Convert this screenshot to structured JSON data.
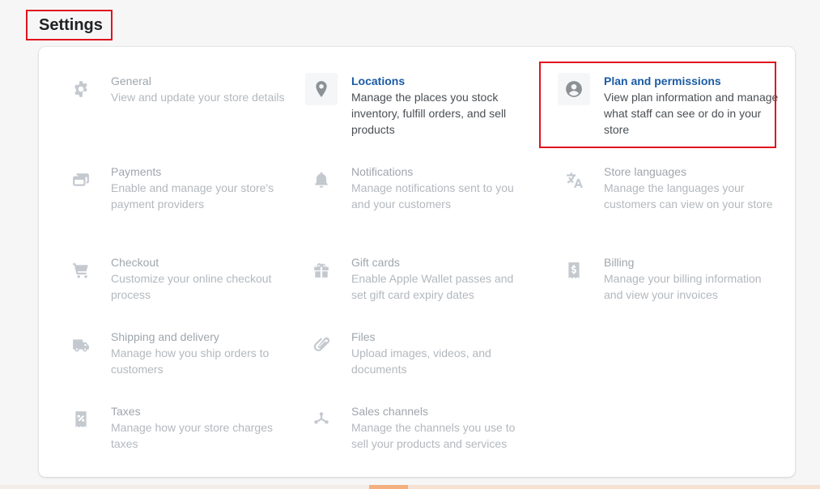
{
  "page": {
    "title": "Settings"
  },
  "settings": [
    {
      "key": "general",
      "icon": "gear-icon",
      "title": "General",
      "description": "View and update your store details"
    },
    {
      "key": "locations",
      "icon": "location-pin-icon",
      "title": "Locations",
      "description": "Manage the places you stock inventory, fulfill orders, and sell products"
    },
    {
      "key": "plan-and-permissions",
      "icon": "user-circle-icon",
      "title": "Plan and permissions",
      "description": "View plan information and manage what staff can see or do in your store"
    },
    {
      "key": "payments",
      "icon": "credit-card-icon",
      "title": "Payments",
      "description": "Enable and manage your store's payment providers"
    },
    {
      "key": "notifications",
      "icon": "bell-icon",
      "title": "Notifications",
      "description": "Manage notifications sent to you and your customers"
    },
    {
      "key": "store-languages",
      "icon": "translate-icon",
      "title": "Store languages",
      "description": "Manage the languages your customers can view on your store"
    },
    {
      "key": "checkout",
      "icon": "cart-icon",
      "title": "Checkout",
      "description": "Customize your online checkout process"
    },
    {
      "key": "gift-cards",
      "icon": "gift-icon",
      "title": "Gift cards",
      "description": "Enable Apple Wallet passes and set gift card expiry dates"
    },
    {
      "key": "billing",
      "icon": "billing-receipt-icon",
      "title": "Billing",
      "description": "Manage your billing information and view your invoices"
    },
    {
      "key": "shipping-and-delivery",
      "icon": "truck-icon",
      "title": "Shipping and delivery",
      "description": "Manage how you ship orders to customers"
    },
    {
      "key": "files",
      "icon": "paperclip-icon",
      "title": "Files",
      "description": "Upload images, videos, and documents"
    },
    {
      "key": "taxes",
      "icon": "tax-receipt-icon",
      "title": "Taxes",
      "description": "Manage how your store charges taxes"
    },
    {
      "key": "sales-channels",
      "icon": "sales-channels-icon",
      "title": "Sales channels",
      "description": "Manage the channels you use to sell your products and services"
    }
  ],
  "colors": {
    "active_title": "#1a5ba6",
    "highlight_border": "#e0141e",
    "muted_text": "#a0a6ac"
  }
}
